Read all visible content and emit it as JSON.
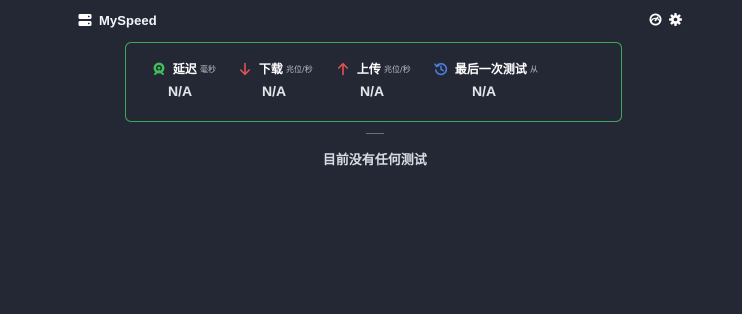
{
  "app": {
    "title": "MySpeed"
  },
  "header": {
    "icons": [
      "speedometer-icon",
      "gear-icon"
    ]
  },
  "stats": [
    {
      "label": "延迟",
      "unit": "毫秒",
      "value": "N/A",
      "icon": "ping-icon",
      "icon_color": "#3fbf5a"
    },
    {
      "label": "下载",
      "unit": "兆位/秒",
      "value": "N/A",
      "icon": "arrow-down-icon",
      "icon_color": "#e05252"
    },
    {
      "label": "上传",
      "unit": "兆位/秒",
      "value": "N/A",
      "icon": "arrow-up-icon",
      "icon_color": "#e05252"
    },
    {
      "label": "最后一次测试",
      "unit": "从",
      "value": "N/A",
      "icon": "history-icon",
      "icon_color": "#4a7fe0"
    }
  ],
  "main": {
    "empty_message": "目前没有任何测试"
  },
  "colors": {
    "background": "#242834",
    "box_border": "#3fa55a",
    "text": "#ffffff",
    "muted": "#b8bcc6"
  }
}
